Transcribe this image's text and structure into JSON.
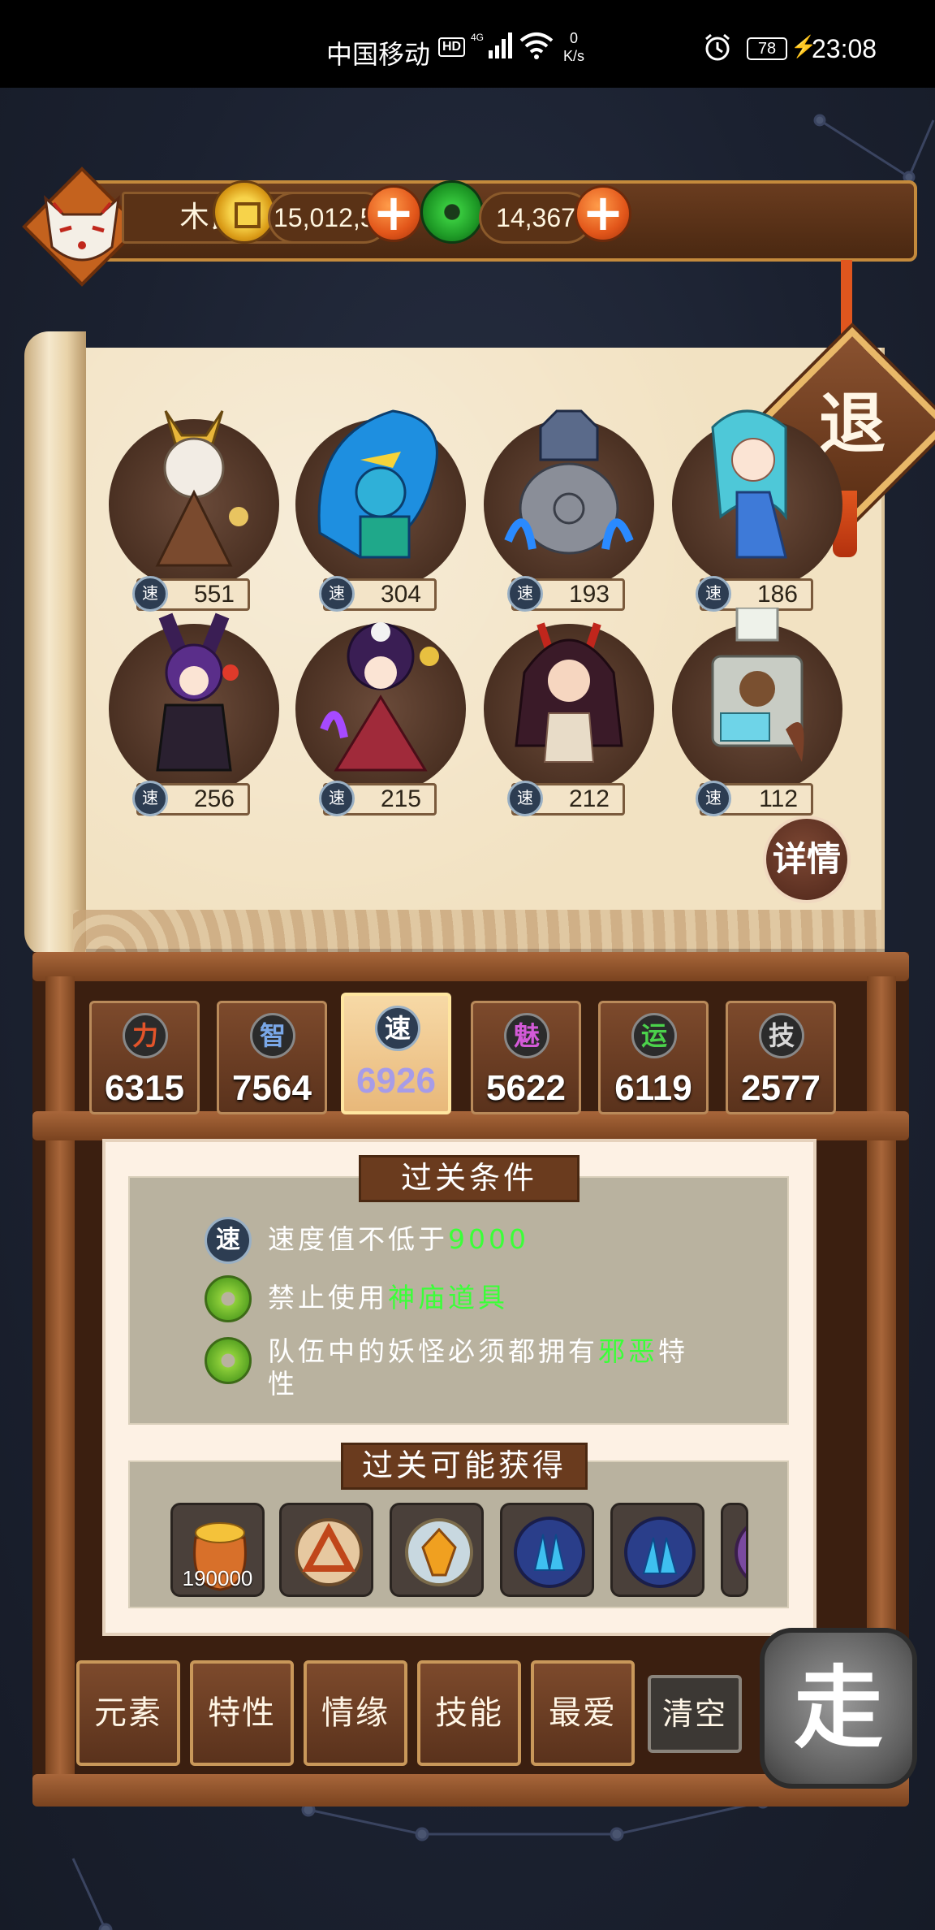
{
  "status_bar": {
    "carrier": "中国移动",
    "hd": "HD",
    "network": "4G",
    "speed_value": "0",
    "speed_unit": "K/s",
    "battery": "78",
    "time": "23:08"
  },
  "top_bar": {
    "player_name": "木良",
    "coins": "15,012,515",
    "jade": "14,367"
  },
  "retreat_label": "退",
  "monsters": [
    {
      "speed_icon": "速",
      "value": "551"
    },
    {
      "speed_icon": "速",
      "value": "304"
    },
    {
      "speed_icon": "速",
      "value": "193"
    },
    {
      "speed_icon": "速",
      "value": "186"
    },
    {
      "speed_icon": "速",
      "value": "256"
    },
    {
      "speed_icon": "速",
      "value": "215"
    },
    {
      "speed_icon": "速",
      "value": "212"
    },
    {
      "speed_icon": "速",
      "value": "112"
    }
  ],
  "detail_label": "详情",
  "stats": [
    {
      "icon": "力",
      "value": "6315",
      "color": "#e3542a"
    },
    {
      "icon": "智",
      "value": "7564",
      "color": "#7aa8e8"
    },
    {
      "icon": "速",
      "value": "6926",
      "color": "#ffffff"
    },
    {
      "icon": "魅",
      "value": "5622",
      "color": "#d45ad8"
    },
    {
      "icon": "运",
      "value": "6119",
      "color": "#4bd24b"
    },
    {
      "icon": "技",
      "value": "2577",
      "color": "#d8d8d8"
    }
  ],
  "conditions": {
    "title": "过关条件",
    "rows": [
      {
        "icon": "速",
        "text": "速度值不低于",
        "highlight": "9000",
        "after": ""
      },
      {
        "icon": "",
        "text": "禁止使用",
        "highlight": "神庙道具",
        "after": ""
      },
      {
        "icon": "",
        "text": "队伍中的妖怪必须都拥有",
        "highlight": "邪恶",
        "after": "特",
        "line2": "性"
      }
    ]
  },
  "rewards": {
    "title": "过关可能获得",
    "items": [
      {
        "icon": "gold-bag-icon",
        "count": "190000"
      },
      {
        "icon": "triangle-rune-icon",
        "count": ""
      },
      {
        "icon": "amber-gem-icon",
        "count": ""
      },
      {
        "icon": "blue-crystal-icon",
        "count": ""
      },
      {
        "icon": "blue-crystal-icon",
        "count": ""
      }
    ]
  },
  "filters": [
    "元素",
    "特性",
    "情缘",
    "技能",
    "最爱",
    "清空"
  ],
  "go_label": "走"
}
